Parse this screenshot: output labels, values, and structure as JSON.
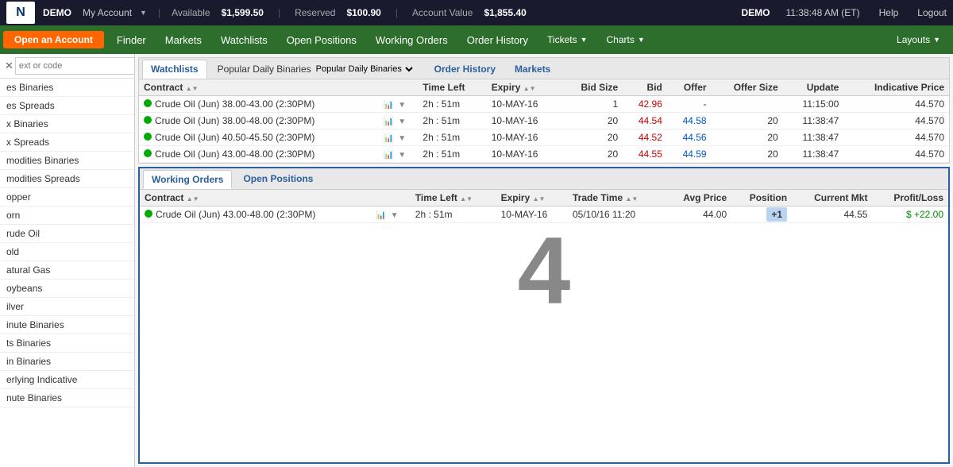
{
  "topbar": {
    "demo_label": "DEMO",
    "myaccount_label": "My Account",
    "available_label": "Available",
    "available_value": "$1,599.50",
    "reserved_label": "Reserved",
    "reserved_value": "$100.90",
    "account_value_label": "Account Value",
    "account_value": "$1,855.40",
    "demo_right": "DEMO",
    "time": "11:38:48 AM (ET)",
    "help": "Help",
    "logout": "Logout"
  },
  "navbar": {
    "open_account": "Open an Account",
    "items": [
      "Finder",
      "Markets",
      "Watchlists",
      "Open Positions",
      "Working Orders",
      "Order History",
      "Tickets",
      "Charts",
      "Layouts"
    ]
  },
  "sidebar": {
    "placeholder": "ext or code",
    "items": [
      "es Binaries",
      "es Spreads",
      "x Binaries",
      "x Spreads",
      "modities Binaries",
      "modities Spreads",
      "opper",
      "orn",
      "rude Oil",
      "old",
      "atural Gas",
      "oybeans",
      "ilver",
      "inute Binaries",
      "ts Binaries",
      "in Binaries",
      "erlying Indicative",
      "nute Binaries"
    ]
  },
  "tabs": {
    "watchlists": "Watchlists",
    "popular_daily": "Popular Daily Binaries",
    "order_history": "Order History",
    "markets": "Markets"
  },
  "table_headers": {
    "contract": "Contract",
    "time_left": "Time Left",
    "expiry": "Expiry",
    "bid_size": "Bid Size",
    "bid": "Bid",
    "offer": "Offer",
    "offer_size": "Offer Size",
    "update": "Update",
    "indicative_price": "Indicative Price"
  },
  "table_rows": [
    {
      "contract": "Crude Oil (Jun) 38.00-43.00 (2:30PM)",
      "time_left": "2h : 51m",
      "expiry": "10-MAY-16",
      "bid_size": "1",
      "bid": "42.96",
      "bid_color": "red",
      "offer": "-",
      "offer_size": "",
      "update": "11:15:00",
      "indicative_price": "44.570"
    },
    {
      "contract": "Crude Oil (Jun) 38.00-48.00 (2:30PM)",
      "time_left": "2h : 51m",
      "expiry": "10-MAY-16",
      "bid_size": "20",
      "bid": "44.54",
      "bid_color": "red",
      "offer": "44.58",
      "offer_color": "blue",
      "offer_size": "20",
      "update": "11:38:47",
      "indicative_price": "44.570"
    },
    {
      "contract": "Crude Oil (Jun) 40.50-45.50 (2:30PM)",
      "time_left": "2h : 51m",
      "expiry": "10-MAY-16",
      "bid_size": "20",
      "bid": "44.52",
      "bid_color": "red",
      "offer": "44.56",
      "offer_color": "blue",
      "offer_size": "20",
      "update": "11:38:47",
      "indicative_price": "44.570"
    },
    {
      "contract": "Crude Oil (Jun) 43.00-48.00 (2:30PM)",
      "time_left": "2h : 51m",
      "expiry": "10-MAY-16",
      "bid_size": "20",
      "bid": "44.55",
      "bid_color": "red",
      "offer": "44.59",
      "offer_color": "blue",
      "offer_size": "20",
      "update": "11:38:47",
      "indicative_price": "44.570"
    }
  ],
  "bottom_tabs": {
    "working_orders": "Working Orders",
    "open_positions": "Open Positions"
  },
  "bottom_table_headers": {
    "contract": "Contract",
    "time_left": "Time Left",
    "expiry": "Expiry",
    "trade_time": "Trade Time",
    "avg_price": "Avg Price",
    "position": "Position",
    "current_mkt": "Current Mkt",
    "profit_loss": "Profit/Loss"
  },
  "bottom_rows": [
    {
      "contract": "Crude Oil (Jun) 43.00-48.00 (2:30PM)",
      "time_left": "2h : 51m",
      "expiry": "10-MAY-16",
      "trade_time": "05/10/16 11:20",
      "avg_price": "44.00",
      "position": "+1",
      "current_mkt": "44.55",
      "profit_loss": "$ +22.00"
    }
  ],
  "big_number": "4",
  "spreads_label": "Spreads"
}
